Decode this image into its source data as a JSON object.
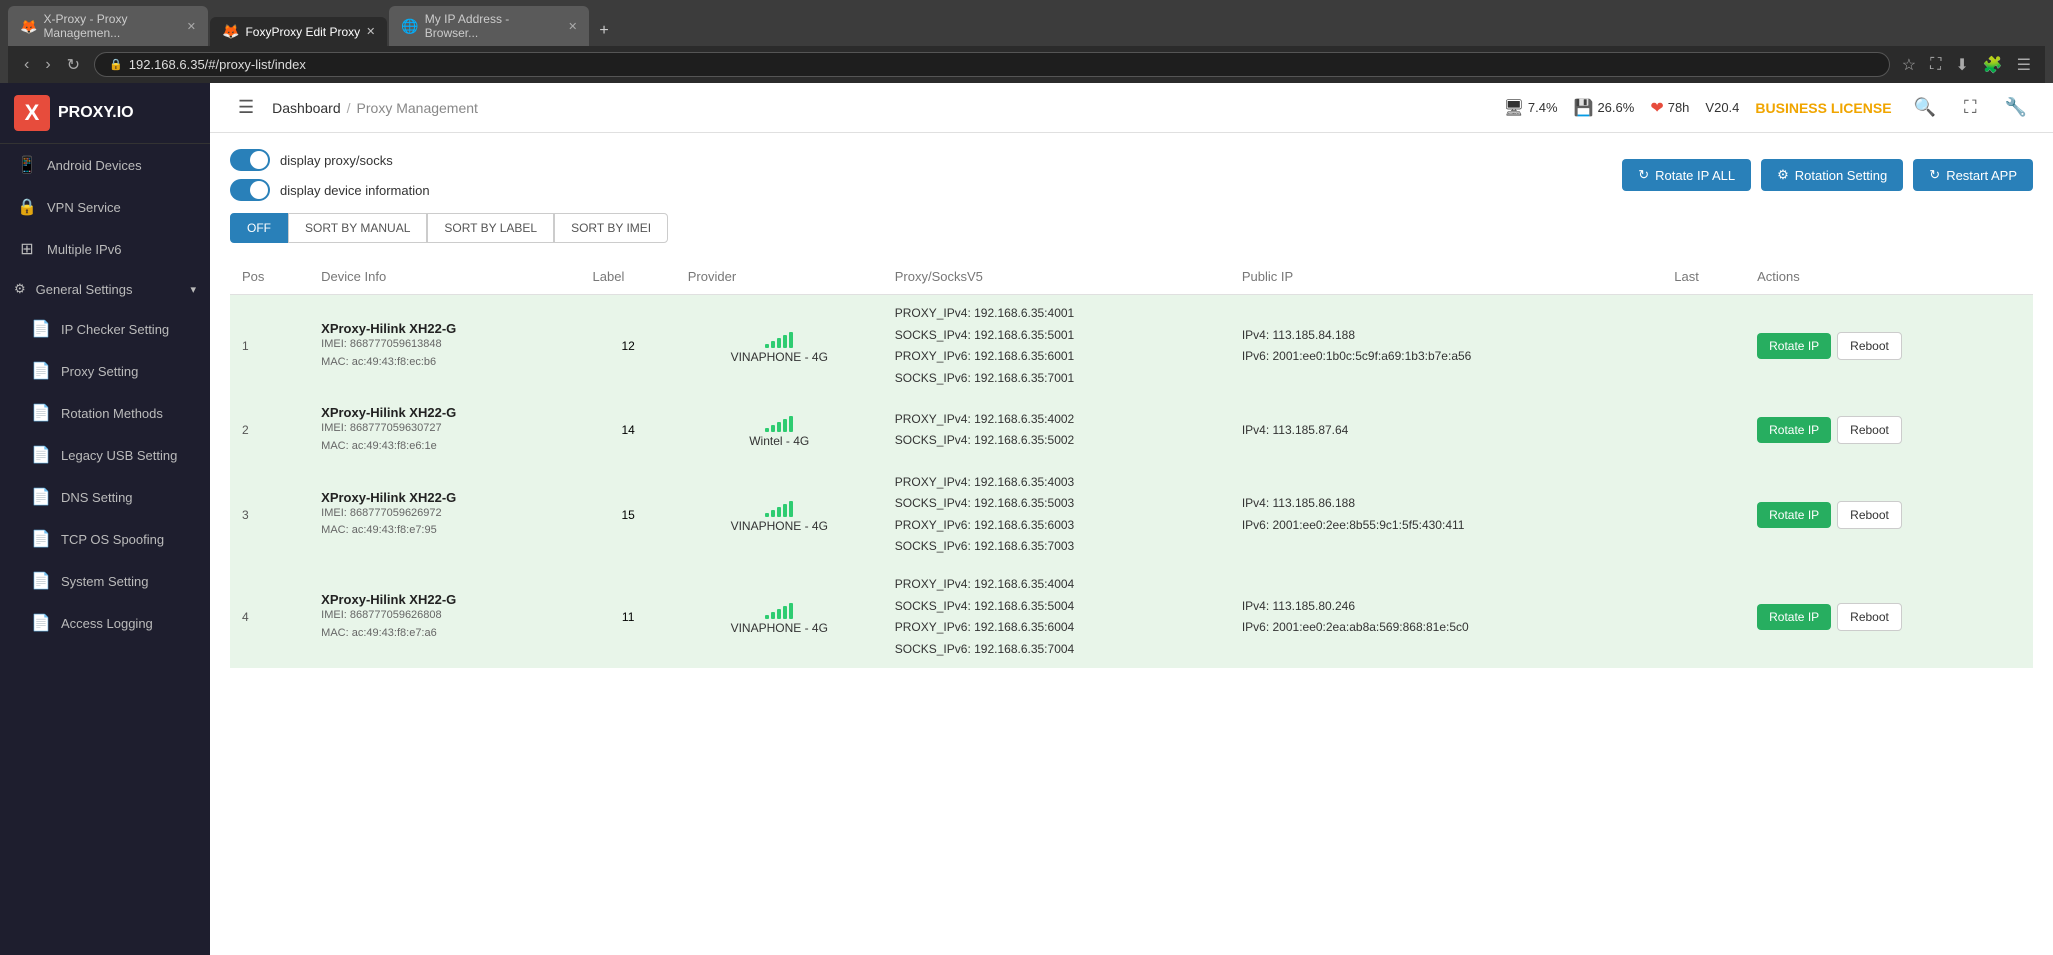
{
  "browser": {
    "tabs": [
      {
        "id": "tab1",
        "icon": "🦊",
        "label": "X-Proxy - Proxy Managemen...",
        "active": false
      },
      {
        "id": "tab2",
        "icon": "🦊",
        "label": "FoxyProxy Edit Proxy",
        "active": true
      },
      {
        "id": "tab3",
        "icon": "🌐",
        "label": "My IP Address - Browser...",
        "active": false
      }
    ],
    "url": "192.168.6.35/#/proxy-list/index",
    "new_tab_label": "+"
  },
  "header": {
    "dashboard_label": "Dashboard",
    "sep": "/",
    "current_label": "Proxy Management",
    "stats": {
      "cpu_icon": "🖥",
      "cpu_value": "7.4%",
      "ram_icon": "💾",
      "ram_value": "26.6%",
      "heart_icon": "❤",
      "uptime": "78h",
      "version": "V20.4",
      "license": "BUSINESS LICENSE"
    }
  },
  "sidebar": {
    "logo_x": "X",
    "logo_text": "PROXY.IO",
    "items": [
      {
        "id": "android-devices",
        "icon": "📱",
        "label": "Android Devices",
        "active": false
      },
      {
        "id": "vpn-service",
        "icon": "🔒",
        "label": "VPN Service",
        "active": false
      },
      {
        "id": "multiple-ipv6",
        "icon": "⊞",
        "label": "Multiple IPv6",
        "active": false
      },
      {
        "id": "general-settings",
        "icon": "⚙",
        "label": "General Settings",
        "expanded": true
      },
      {
        "id": "ip-checker-setting",
        "icon": "📄",
        "label": "IP Checker Setting",
        "sub": true
      },
      {
        "id": "proxy-setting",
        "icon": "📄",
        "label": "Proxy Setting",
        "sub": true
      },
      {
        "id": "rotation-methods",
        "icon": "📄",
        "label": "Rotation Methods",
        "sub": true
      },
      {
        "id": "legacy-usb-setting",
        "icon": "📄",
        "label": "Legacy USB Setting",
        "sub": true
      },
      {
        "id": "dns-setting",
        "icon": "📄",
        "label": "DNS Setting",
        "sub": true
      },
      {
        "id": "tcp-os-spoofing",
        "icon": "📄",
        "label": "TCP OS Spoofing",
        "sub": true
      },
      {
        "id": "system-setting",
        "icon": "📄",
        "label": "System Setting",
        "sub": true
      },
      {
        "id": "access-logging",
        "icon": "📄",
        "label": "Access Logging",
        "sub": true
      }
    ]
  },
  "controls": {
    "toggle1_label": "display proxy/socks",
    "toggle2_label": "display device information",
    "btn_rotate_all": "Rotate IP ALL",
    "btn_rotation_setting": "Rotation Setting",
    "btn_restart_app": "Restart APP"
  },
  "sort_buttons": [
    {
      "id": "off",
      "label": "OFF",
      "active": true
    },
    {
      "id": "manual",
      "label": "SORT BY MANUAL",
      "active": false
    },
    {
      "id": "label",
      "label": "SORT BY LABEL",
      "active": false
    },
    {
      "id": "imei",
      "label": "SORT BY IMEI",
      "active": false
    }
  ],
  "table": {
    "columns": [
      "Pos",
      "Device Info",
      "Label",
      "Provider",
      "Proxy/SocksV5",
      "Public IP",
      "Last",
      "Actions"
    ],
    "rows": [
      {
        "pos": "1",
        "device_name": "XProxy-Hilink XH22-G",
        "device_imei": "IMEI: 868777059613848",
        "device_mac": "MAC: ac:49:43:f8:ec:b6",
        "label": "12",
        "provider": "VINAPHONE - 4G",
        "signal_bars": [
          4,
          7,
          10,
          13,
          16
        ],
        "proxy_lines": [
          "PROXY_IPv4: 192.168.6.35:4001",
          "SOCKS_IPv4: 192.168.6.35:5001",
          "PROXY_IPv6: 192.168.6.35:6001",
          "SOCKS_IPv6: 192.168.6.35:7001"
        ],
        "public_ip_lines": [
          "IPv4: 113.185.84.188",
          "IPv6: 2001:ee0:1b0c:5c9f:a69:1b3:b7e:a56"
        ],
        "btn_rotate": "Rotate IP",
        "btn_reboot": "Reboot"
      },
      {
        "pos": "2",
        "device_name": "XProxy-Hilink XH22-G",
        "device_imei": "IMEI: 868777059630727",
        "device_mac": "MAC: ac:49:43:f8:e6:1e",
        "label": "14",
        "provider": "Wintel - 4G",
        "signal_bars": [
          4,
          7,
          10,
          13,
          16
        ],
        "proxy_lines": [
          "PROXY_IPv4: 192.168.6.35:4002",
          "SOCKS_IPv4: 192.168.6.35:5002"
        ],
        "public_ip_lines": [
          "IPv4: 113.185.87.64"
        ],
        "btn_rotate": "Rotate IP",
        "btn_reboot": "Reboot"
      },
      {
        "pos": "3",
        "device_name": "XProxy-Hilink XH22-G",
        "device_imei": "IMEI: 868777059626972",
        "device_mac": "MAC: ac:49:43:f8:e7:95",
        "label": "15",
        "provider": "VINAPHONE - 4G",
        "signal_bars": [
          4,
          7,
          10,
          13,
          16
        ],
        "proxy_lines": [
          "PROXY_IPv4: 192.168.6.35:4003",
          "SOCKS_IPv4: 192.168.6.35:5003",
          "PROXY_IPv6: 192.168.6.35:6003",
          "SOCKS_IPv6: 192.168.6.35:7003"
        ],
        "public_ip_lines": [
          "IPv4: 113.185.86.188",
          "IPv6: 2001:ee0:2ee:8b55:9c1:5f5:430:411"
        ],
        "btn_rotate": "Rotate IP",
        "btn_reboot": "Reboot"
      },
      {
        "pos": "4",
        "device_name": "XProxy-Hilink XH22-G",
        "device_imei": "IMEI: 868777059626808",
        "device_mac": "MAC: ac:49:43:f8:e7:a6",
        "label": "11",
        "provider": "VINAPHONE - 4G",
        "signal_bars": [
          4,
          7,
          10,
          13,
          16
        ],
        "proxy_lines": [
          "PROXY_IPv4: 192.168.6.35:4004",
          "SOCKS_IPv4: 192.168.6.35:5004",
          "PROXY_IPv6: 192.168.6.35:6004",
          "SOCKS_IPv6: 192.168.6.35:7004"
        ],
        "public_ip_lines": [
          "IPv4: 113.185.80.246",
          "IPv6: 2001:ee0:2ea:ab8a:569:868:81e:5c0"
        ],
        "btn_rotate": "Rotate IP",
        "btn_reboot": "Reboot"
      }
    ]
  }
}
